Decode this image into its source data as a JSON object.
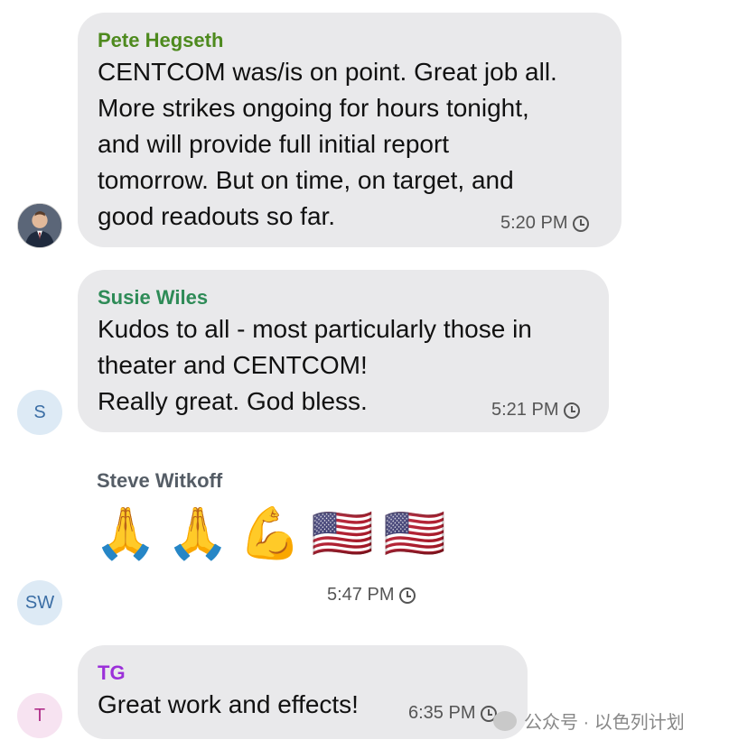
{
  "messages": [
    {
      "sender": "Pete Hegseth",
      "sender_color": "#4e8a1e",
      "text": "CENTCOM was/is on point. Great job all.\nMore strikes ongoing for hours tonight,\nand will provide full initial report\ntomorrow. But on time, on target, and\ngood readouts so far.",
      "time": "5:20 PM",
      "avatar": "photo"
    },
    {
      "sender": "Susie Wiles",
      "sender_color": "#2e8b57",
      "text": "Kudos to all - most particularly those in\ntheater and CENTCOM!\nReally great. God bless.",
      "time": "5:21 PM",
      "avatar": "S"
    },
    {
      "sender": "Steve Witkoff",
      "sender_color": "#555d66",
      "emojis": [
        "🙏",
        "🙏",
        "💪",
        "🇺🇸",
        "🇺🇸"
      ],
      "time": "5:47 PM",
      "avatar": "SW"
    },
    {
      "sender": "TG",
      "sender_color": "#9b30d9",
      "text": "Great work and effects!",
      "time": "6:35 PM",
      "avatar": "T"
    }
  ],
  "watermark": "公众号 · 以色列计划",
  "icons": {
    "clock": "clock-icon",
    "watermark": "wechat-icon"
  },
  "colors": {
    "bubble": "#e9e9eb",
    "avatar_bg": "#ddeaf5",
    "avatar_t_bg": "#f7e3f1"
  }
}
